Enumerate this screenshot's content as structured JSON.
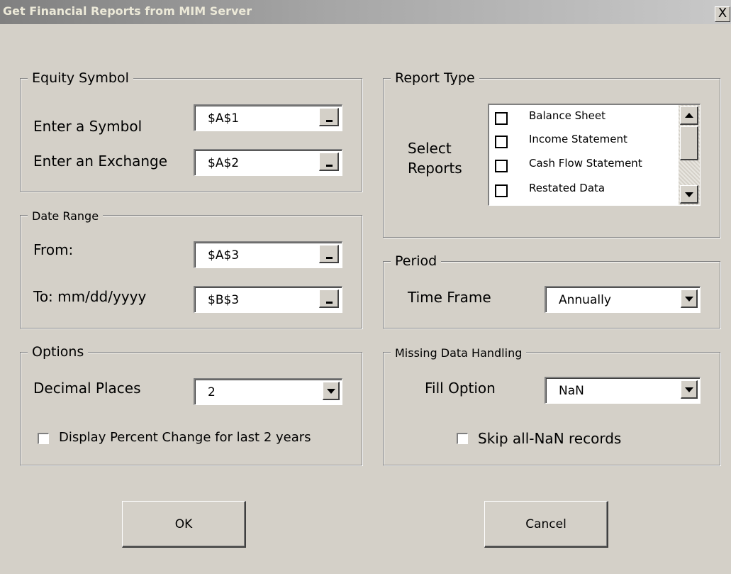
{
  "window": {
    "title": "Get Financial Reports from MIM Server",
    "close_label": "X"
  },
  "equity": {
    "legend": "Equity Symbol",
    "symbol_label": "Enter a Symbol",
    "symbol_value": "$A$1",
    "exchange_label": "Enter an Exchange",
    "exchange_value": "$A$2"
  },
  "date_range": {
    "legend": "Date Range",
    "from_label": "From:",
    "from_value": "$A$3",
    "to_label": "To: mm/dd/yyyy",
    "to_value": "$B$3"
  },
  "options": {
    "legend": "Options",
    "decimal_label": "Decimal Places",
    "decimal_value": "2",
    "percent_change_label": "Display Percent Change for last 2 years",
    "percent_change_checked": false
  },
  "report_type": {
    "legend": "Report Type",
    "select_label_line1": "Select",
    "select_label_line2": "Reports",
    "items": [
      {
        "label": "Balance Sheet",
        "checked": false
      },
      {
        "label": "Income Statement",
        "checked": false
      },
      {
        "label": "Cash Flow Statement",
        "checked": false
      },
      {
        "label": "Restated Data",
        "checked": false
      }
    ]
  },
  "period": {
    "legend": "Period",
    "time_frame_label": "Time Frame",
    "time_frame_value": "Annually"
  },
  "missing_data": {
    "legend": "Missing Data Handling",
    "fill_label": "Fill Option",
    "fill_value": "NaN",
    "skip_label": "Skip all-NaN records",
    "skip_checked": false
  },
  "buttons": {
    "ok": "OK",
    "cancel": "Cancel"
  },
  "icons": {
    "close": "close-icon",
    "ref": "range-select-icon",
    "dropdown": "chevron-down-icon"
  }
}
